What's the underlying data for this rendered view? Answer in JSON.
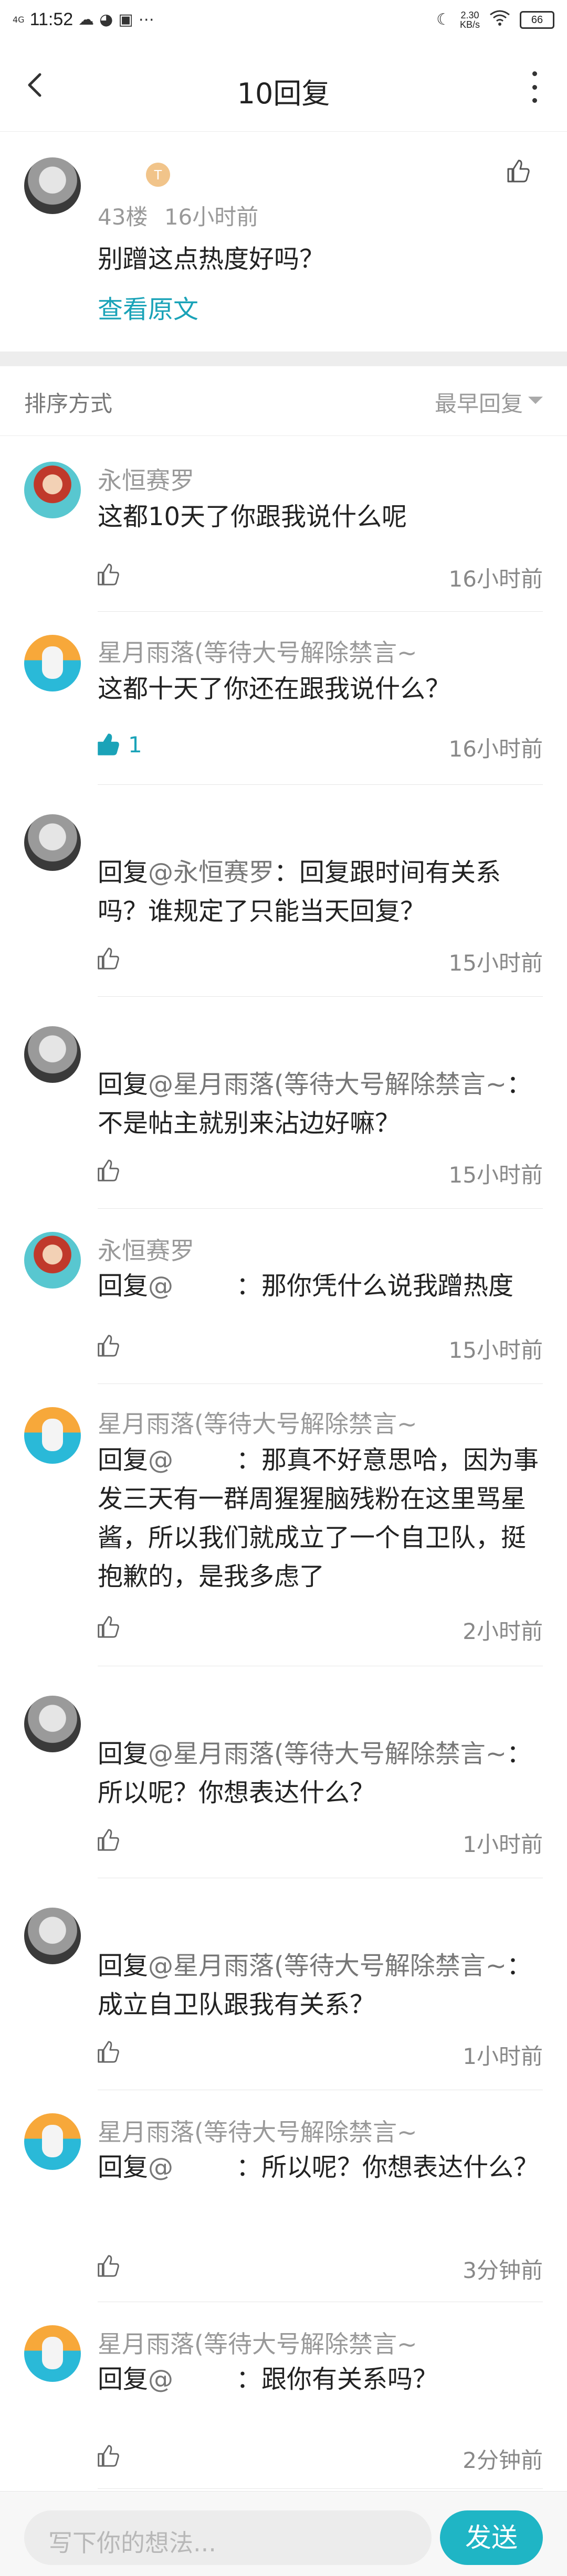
{
  "status": {
    "signal": "4G",
    "time": "11:52",
    "speed_value": "2.30",
    "speed_unit": "KB/s",
    "battery": "66",
    "icons": [
      "signal-icon",
      "cloud-icon",
      "wechat-icon",
      "notification-icon",
      "more-dots-icon",
      "moon-icon",
      "wifi-icon",
      "battery-icon"
    ]
  },
  "header": {
    "title": "10回复"
  },
  "post": {
    "badge": "T",
    "floor": "43楼",
    "time": "16小时前",
    "text": "别蹭这点热度好吗？",
    "view_original": "查看原文"
  },
  "sort": {
    "label": "排序方式",
    "value": "最早回复"
  },
  "replies": [
    {
      "avatar": "green",
      "username": "永恒赛罗",
      "prefix": "",
      "mention": "",
      "text": "这都10天了你跟我说什么呢",
      "likes": "",
      "time": "16小时前"
    },
    {
      "avatar": "sunset",
      "username": "星月雨落(等待大号解除禁言~",
      "prefix": "",
      "mention": "",
      "text": "这都十天了你还在跟我说什么？",
      "likes": "1",
      "time": "16小时前"
    },
    {
      "avatar": "gray",
      "username": "",
      "prefix": "回复",
      "mention": "@永恒赛罗",
      "text": "：回复跟时间有关系吗？谁规定了只能当天回复？",
      "likes": "",
      "time": "15小时前"
    },
    {
      "avatar": "gray",
      "username": "",
      "prefix": "回复",
      "mention": "@星月雨落(等待大号解除禁言~",
      "text": "：不是帖主就别来沾边好嘛？",
      "likes": "",
      "time": "15小时前"
    },
    {
      "avatar": "green",
      "username": "永恒赛罗",
      "prefix": "回复",
      "mention": "@",
      "text": "：那你凭什么说我蹭热度",
      "likes": "",
      "time": "15小时前"
    },
    {
      "avatar": "sunset",
      "username": "星月雨落(等待大号解除禁言~",
      "prefix": "回复",
      "mention": "@",
      "text": "：那真不好意思哈，因为事发三天有一群周猩猩脑残粉在这里骂星酱，所以我们就成立了一个自卫队，挺抱歉的，是我多虑了",
      "likes": "",
      "time": "2小时前"
    },
    {
      "avatar": "gray",
      "username": "",
      "prefix": "回复",
      "mention": "@星月雨落(等待大号解除禁言~",
      "text": "：所以呢？你想表达什么？",
      "likes": "",
      "time": "1小时前"
    },
    {
      "avatar": "gray",
      "username": "",
      "prefix": "回复",
      "mention": "@星月雨落(等待大号解除禁言~",
      "text": "：成立自卫队跟我有关系？",
      "likes": "",
      "time": "1小时前"
    },
    {
      "avatar": "sunset",
      "username": "星月雨落(等待大号解除禁言~",
      "prefix": "回复",
      "mention": "@",
      "text": "：所以呢？你想表达什么？",
      "likes": "",
      "time": "3分钟前"
    },
    {
      "avatar": "sunset",
      "username": "星月雨落(等待大号解除禁言~",
      "prefix": "回复",
      "mention": "@",
      "text": "：跟你有关系吗？",
      "likes": "",
      "time": "2分钟前"
    }
  ],
  "composer": {
    "placeholder": "写下你的想法...",
    "send": "发送"
  },
  "colors": {
    "accent": "#1fb5c5",
    "link": "#1aa3b8",
    "divider": "#ededed"
  }
}
